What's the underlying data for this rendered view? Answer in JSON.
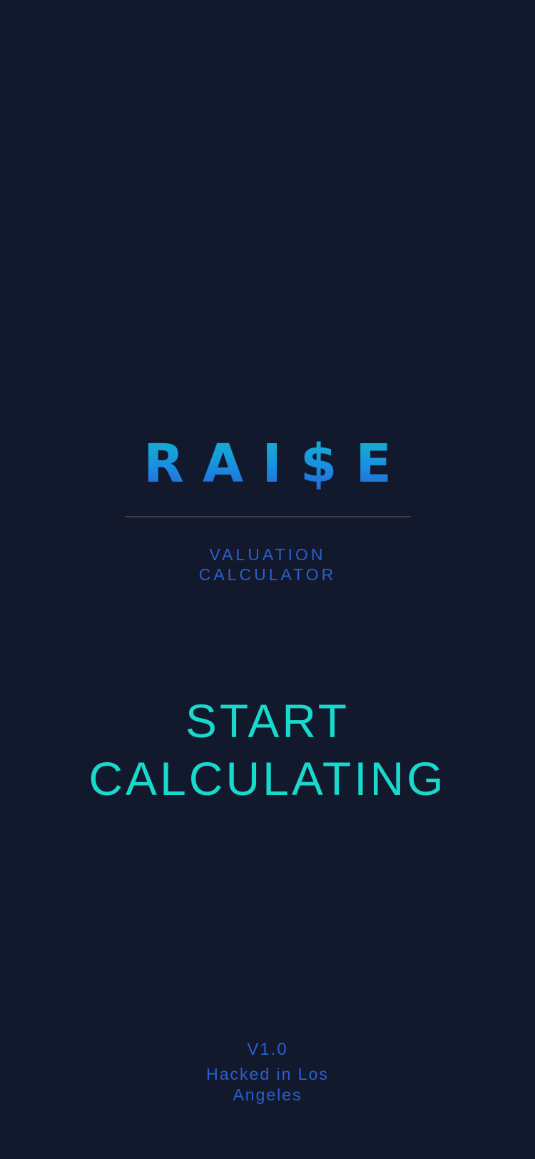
{
  "app": {
    "logo_text": "RAI$E",
    "subtitle_lines": [
      "VALUATION",
      "CALCULATOR"
    ],
    "cta_lines": [
      "START",
      "CALCULATING"
    ],
    "version": "V1.0",
    "credit_lines": [
      "Hacked in Los",
      "Angeles"
    ]
  },
  "colors": {
    "background": "#13192d",
    "accent_teal": "#19d9cc",
    "accent_blue": "#2a5fd0",
    "logo_gradient_top": "#14b8cc",
    "logo_gradient_bottom": "#2361d8",
    "divider": "#3a3e4e"
  }
}
